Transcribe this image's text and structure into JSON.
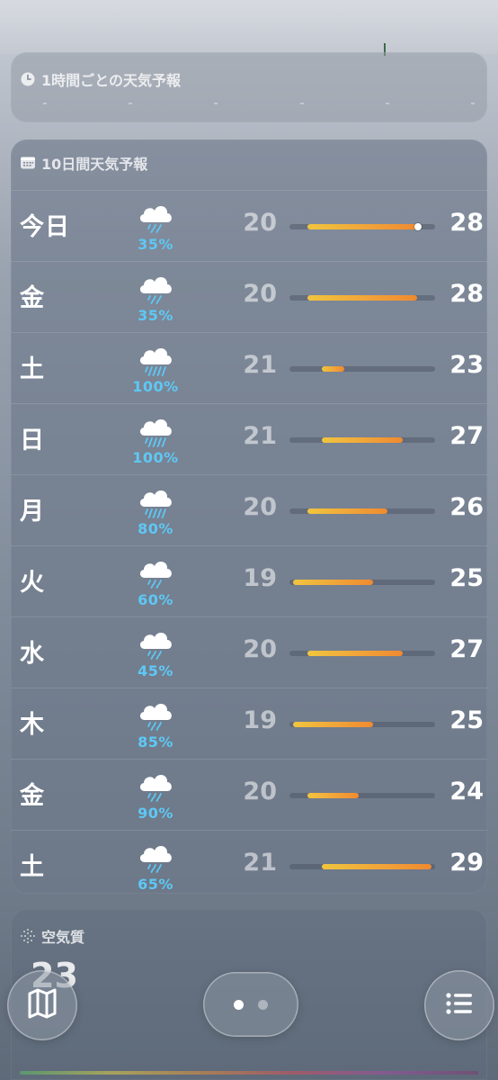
{
  "hourly": {
    "title": "1時間ごとの天気予報",
    "icon": "clock-icon"
  },
  "ten_day": {
    "title": "10日間天気予報",
    "icon": "calendar-icon",
    "range_min": 19,
    "range_max": 29,
    "bar_color_start": "#f0c53e",
    "bar_color_end": "#ef8a30",
    "precip_color": "#5ec8f5",
    "days": [
      {
        "day": "今日",
        "icon": "rain-cloud-icon",
        "chance": "35%",
        "low": "20",
        "high": "28",
        "lo_val": 20,
        "hi_val": 28,
        "current": 27.8
      },
      {
        "day": "金",
        "icon": "rain-cloud-icon",
        "chance": "35%",
        "low": "20",
        "high": "28",
        "lo_val": 20,
        "hi_val": 28
      },
      {
        "day": "土",
        "icon": "heavy-rain-cloud-icon",
        "chance": "100%",
        "low": "21",
        "high": "23",
        "lo_val": 21,
        "hi_val": 23
      },
      {
        "day": "日",
        "icon": "heavy-rain-cloud-icon",
        "chance": "100%",
        "low": "21",
        "high": "27",
        "lo_val": 21,
        "hi_val": 27
      },
      {
        "day": "月",
        "icon": "heavy-rain-cloud-icon",
        "chance": "80%",
        "low": "20",
        "high": "26",
        "lo_val": 20,
        "hi_val": 26
      },
      {
        "day": "火",
        "icon": "rain-cloud-icon",
        "chance": "60%",
        "low": "19",
        "high": "25",
        "lo_val": 19,
        "hi_val": 25
      },
      {
        "day": "水",
        "icon": "rain-cloud-icon",
        "chance": "45%",
        "low": "20",
        "high": "27",
        "lo_val": 20,
        "hi_val": 27
      },
      {
        "day": "木",
        "icon": "rain-cloud-icon",
        "chance": "85%",
        "low": "19",
        "high": "25",
        "lo_val": 19,
        "hi_val": 25
      },
      {
        "day": "金",
        "icon": "rain-cloud-icon",
        "chance": "90%",
        "low": "20",
        "high": "24",
        "lo_val": 20,
        "hi_val": 24
      },
      {
        "day": "土",
        "icon": "rain-cloud-icon",
        "chance": "65%",
        "low": "21",
        "high": "29",
        "lo_val": 21,
        "hi_val": 29
      }
    ]
  },
  "air_quality": {
    "title": "空気質",
    "icon": "air-quality-icon",
    "value": "23"
  },
  "toolbar": {
    "map_icon": "map-icon",
    "list_icon": "list-icon",
    "pages": 2,
    "active_page": 0
  }
}
